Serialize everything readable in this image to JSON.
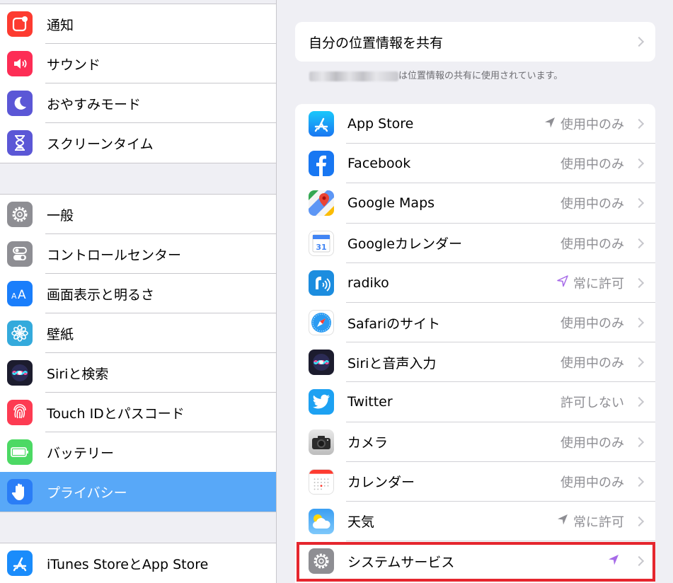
{
  "sidebar": {
    "group1": [
      {
        "label": "通知",
        "icon": "notification-icon",
        "color": "#fd3b30"
      },
      {
        "label": "サウンド",
        "icon": "speaker-icon",
        "color": "#fd2d55"
      },
      {
        "label": "おやすみモード",
        "icon": "moon-icon",
        "color": "#5b57d6"
      },
      {
        "label": "スクリーンタイム",
        "icon": "hourglass-icon",
        "color": "#5b57d6"
      }
    ],
    "group2": [
      {
        "label": "一般",
        "icon": "gear-icon",
        "color": "#8e8e93"
      },
      {
        "label": "コントロールセンター",
        "icon": "toggle-icon",
        "color": "#8e8e93"
      },
      {
        "label": "画面表示と明るさ",
        "icon": "text-size-icon",
        "color": "#1a7efb"
      },
      {
        "label": "壁紙",
        "icon": "flower-icon",
        "color": "#34aadc"
      },
      {
        "label": "Siriと検索",
        "icon": "siri-icon",
        "color": "#1c1c2e"
      },
      {
        "label": "Touch IDとパスコード",
        "icon": "fingerprint-icon",
        "color": "#fd3b52"
      },
      {
        "label": "バッテリー",
        "icon": "battery-icon",
        "color": "#4cd964"
      },
      {
        "label": "プライバシー",
        "icon": "hand-icon",
        "color": "#2a7df6",
        "selected": true
      }
    ],
    "group3": [
      {
        "label": "iTunes StoreとApp Store",
        "icon": "app-store-icon",
        "color": "#1a8cfb"
      }
    ]
  },
  "main": {
    "share_label": "自分の位置情報を共有",
    "footnote_suffix": "は位置情報の共有に使用されています。",
    "apps": [
      {
        "label": "App Store",
        "status": "使用中のみ",
        "arrow": "gray",
        "icon": "app-store-icon"
      },
      {
        "label": "Facebook",
        "status": "使用中のみ",
        "arrow": "",
        "icon": "facebook-icon"
      },
      {
        "label": "Google Maps",
        "status": "使用中のみ",
        "arrow": "",
        "icon": "google-maps-icon"
      },
      {
        "label": "Googleカレンダー",
        "status": "使用中のみ",
        "arrow": "",
        "icon": "google-calendar-icon",
        "icon_text": "31"
      },
      {
        "label": "radiko",
        "status": "常に許可",
        "arrow": "purple-outline",
        "icon": "radiko-icon"
      },
      {
        "label": "Safariのサイト",
        "status": "使用中のみ",
        "arrow": "",
        "icon": "safari-icon"
      },
      {
        "label": "Siriと音声入力",
        "status": "使用中のみ",
        "arrow": "",
        "icon": "siri-icon"
      },
      {
        "label": "Twitter",
        "status": "許可しない",
        "arrow": "",
        "icon": "twitter-icon"
      },
      {
        "label": "カメラ",
        "status": "使用中のみ",
        "arrow": "",
        "icon": "camera-icon"
      },
      {
        "label": "カレンダー",
        "status": "使用中のみ",
        "arrow": "",
        "icon": "calendar-icon"
      },
      {
        "label": "天気",
        "status": "常に許可",
        "arrow": "gray",
        "icon": "weather-icon"
      },
      {
        "label": "システムサービス",
        "status": "",
        "arrow": "purple",
        "icon": "gear-icon"
      }
    ]
  },
  "colors": {
    "selected_row": "#58a8f8",
    "highlight_border": "#e5262e",
    "arrow_gray": "#8e8e93",
    "arrow_purple": "#a66ae8"
  }
}
